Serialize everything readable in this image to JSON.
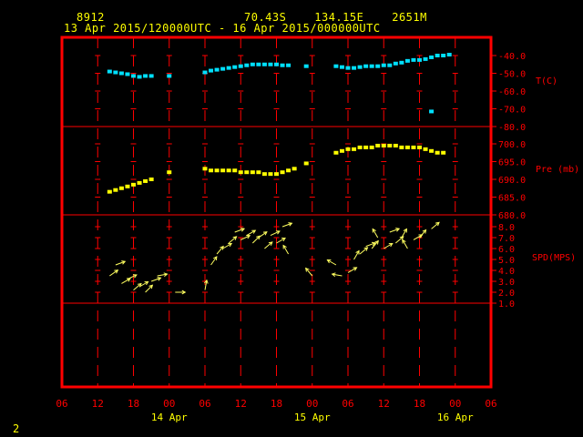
{
  "header": {
    "station": "8912",
    "location": "70.43S    134.15E    2651M",
    "time_range": "13 Apr 2015/120000UTC - 16 Apr 2015/000000UTC",
    "page_number": "2"
  },
  "colors": {
    "frame": "#ff0000",
    "grid": "#ff0000",
    "temperature": "#00e0ff",
    "pressure": "#ffff00",
    "wind": "#ffff60",
    "text_axis": "#ff0000",
    "text_time": "#ffff00",
    "background": "#000000"
  },
  "chart_data": {
    "type": "scatter",
    "x_unit": "hours from 13 Apr 2015 06 UTC",
    "x_range": [
      0,
      72
    ],
    "x_ticks": [
      {
        "t": 0,
        "label": "06"
      },
      {
        "t": 6,
        "label": "12"
      },
      {
        "t": 12,
        "label": "18"
      },
      {
        "t": 18,
        "label": "00"
      },
      {
        "t": 24,
        "label": "06"
      },
      {
        "t": 30,
        "label": "12"
      },
      {
        "t": 36,
        "label": "18"
      },
      {
        "t": 42,
        "label": "00"
      },
      {
        "t": 48,
        "label": "06"
      },
      {
        "t": 54,
        "label": "12"
      },
      {
        "t": 60,
        "label": "18"
      },
      {
        "t": 66,
        "label": "00"
      },
      {
        "t": 72,
        "label": "06"
      }
    ],
    "date_labels": [
      {
        "t": 18,
        "label": "14 Apr"
      },
      {
        "t": 42,
        "label": "15 Apr"
      },
      {
        "t": 66,
        "label": "16 Apr"
      }
    ],
    "panels": [
      {
        "name": "temperature",
        "label": "T(C)",
        "tick_labels": [
          "-40.0",
          "-50.0",
          "-60.0",
          "-70.0",
          "-80.0"
        ],
        "tick_values": [
          -40,
          -50,
          -60,
          -70,
          -80
        ],
        "ylim": [
          -80,
          -35
        ],
        "points": [
          [
            8,
            -49
          ],
          [
            9,
            -49.5
          ],
          [
            10,
            -50
          ],
          [
            11,
            -50.5
          ],
          [
            12,
            -51.5
          ],
          [
            13,
            -52
          ],
          [
            14,
            -51.5
          ],
          [
            15,
            -51.5
          ],
          [
            18,
            -51.5
          ],
          [
            24,
            -49.5
          ],
          [
            25,
            -48.5
          ],
          [
            26,
            -48
          ],
          [
            27,
            -47.5
          ],
          [
            28,
            -47
          ],
          [
            29,
            -46.5
          ],
          [
            30,
            -46
          ],
          [
            31,
            -45.5
          ],
          [
            32,
            -45
          ],
          [
            33,
            -45
          ],
          [
            34,
            -45
          ],
          [
            35,
            -45
          ],
          [
            36,
            -45
          ],
          [
            37,
            -45.5
          ],
          [
            38,
            -45.5
          ],
          [
            41,
            -46
          ],
          [
            46,
            -46
          ],
          [
            47,
            -46.5
          ],
          [
            48,
            -47
          ],
          [
            49,
            -47
          ],
          [
            50,
            -46.5
          ],
          [
            51,
            -46
          ],
          [
            52,
            -46
          ],
          [
            53,
            -46
          ],
          [
            54,
            -45.5
          ],
          [
            55,
            -45.5
          ],
          [
            56,
            -44.5
          ],
          [
            57,
            -44
          ],
          [
            58,
            -43
          ],
          [
            59,
            -42.5
          ],
          [
            60,
            -42.5
          ],
          [
            61,
            -42
          ],
          [
            62,
            -41
          ],
          [
            63,
            -40
          ],
          [
            64,
            -40
          ],
          [
            65,
            -39.5
          ],
          [
            62,
            -71.5
          ]
        ]
      },
      {
        "name": "pressure",
        "label": "Pre (mb)",
        "tick_labels": [
          "700.0",
          "695.0",
          "690.0",
          "685.0",
          "680.0"
        ],
        "tick_values": [
          700,
          695,
          690,
          685,
          680
        ],
        "ylim": [
          680,
          705
        ],
        "points": [
          [
            8,
            686.5
          ],
          [
            9,
            687
          ],
          [
            10,
            687.5
          ],
          [
            11,
            688
          ],
          [
            12,
            688.5
          ],
          [
            13,
            689
          ],
          [
            14,
            689.5
          ],
          [
            15,
            690
          ],
          [
            18,
            692
          ],
          [
            24,
            693
          ],
          [
            25,
            692.5
          ],
          [
            26,
            692.5
          ],
          [
            27,
            692.5
          ],
          [
            28,
            692.5
          ],
          [
            29,
            692.5
          ],
          [
            30,
            692
          ],
          [
            31,
            692
          ],
          [
            32,
            692
          ],
          [
            33,
            692
          ],
          [
            34,
            691.5
          ],
          [
            35,
            691.5
          ],
          [
            36,
            691.5
          ],
          [
            37,
            692
          ],
          [
            38,
            692.5
          ],
          [
            39,
            693
          ],
          [
            41,
            694.5
          ],
          [
            46,
            697.5
          ],
          [
            47,
            698
          ],
          [
            48,
            698.5
          ],
          [
            49,
            698.5
          ],
          [
            50,
            699
          ],
          [
            51,
            699
          ],
          [
            52,
            699
          ],
          [
            53,
            699.5
          ],
          [
            54,
            699.5
          ],
          [
            55,
            699.5
          ],
          [
            56,
            699.5
          ],
          [
            57,
            699
          ],
          [
            58,
            699
          ],
          [
            59,
            699
          ],
          [
            60,
            699
          ],
          [
            61,
            698.5
          ],
          [
            62,
            698
          ],
          [
            63,
            697.5
          ],
          [
            64,
            697.5
          ]
        ]
      },
      {
        "name": "wind",
        "label": "SPD(MPS)",
        "tick_labels": [
          "8.0",
          "7.0",
          "6.0",
          "5.0",
          "4.0",
          "3.0",
          "2.0",
          "1.0"
        ],
        "tick_values": [
          8,
          7,
          6,
          5,
          4,
          3,
          2,
          1
        ],
        "ylim": [
          0,
          8.5
        ],
        "points": [
          [
            8,
            3.5,
            35
          ],
          [
            9,
            4.5,
            20
          ],
          [
            10,
            2.8,
            30
          ],
          [
            11,
            3.2,
            25
          ],
          [
            12,
            2.2,
            40
          ],
          [
            13,
            2.5,
            30
          ],
          [
            14,
            2.0,
            45
          ],
          [
            15,
            3.0,
            20
          ],
          [
            16,
            3.5,
            10
          ],
          [
            19,
            2.0,
            0
          ],
          [
            24,
            2.2,
            80
          ],
          [
            25,
            4.5,
            55
          ],
          [
            26,
            5.5,
            50
          ],
          [
            27,
            6.0,
            30
          ],
          [
            28,
            6.5,
            40
          ],
          [
            29,
            7.5,
            20
          ],
          [
            30,
            6.8,
            25
          ],
          [
            31,
            7.2,
            30
          ],
          [
            32,
            6.5,
            45
          ],
          [
            33,
            7.0,
            35
          ],
          [
            34,
            6.0,
            40
          ],
          [
            35,
            7.2,
            25
          ],
          [
            36,
            6.5,
            30
          ],
          [
            37,
            8.0,
            20
          ],
          [
            38,
            5.5,
            120
          ],
          [
            42,
            3.5,
            130
          ],
          [
            46,
            4.5,
            150
          ],
          [
            47,
            3.5,
            170
          ],
          [
            48,
            3.8,
            30
          ],
          [
            49,
            5.0,
            60
          ],
          [
            50,
            5.5,
            40
          ],
          [
            51,
            6.2,
            20
          ],
          [
            52,
            6.0,
            50
          ],
          [
            53,
            7.0,
            120
          ],
          [
            54,
            6.0,
            30
          ],
          [
            55,
            7.5,
            20
          ],
          [
            56,
            6.5,
            40
          ],
          [
            57,
            7.0,
            60
          ],
          [
            58,
            6.0,
            120
          ],
          [
            59,
            6.8,
            30
          ],
          [
            60,
            7.0,
            50
          ],
          [
            62,
            7.8,
            40
          ]
        ]
      }
    ]
  }
}
